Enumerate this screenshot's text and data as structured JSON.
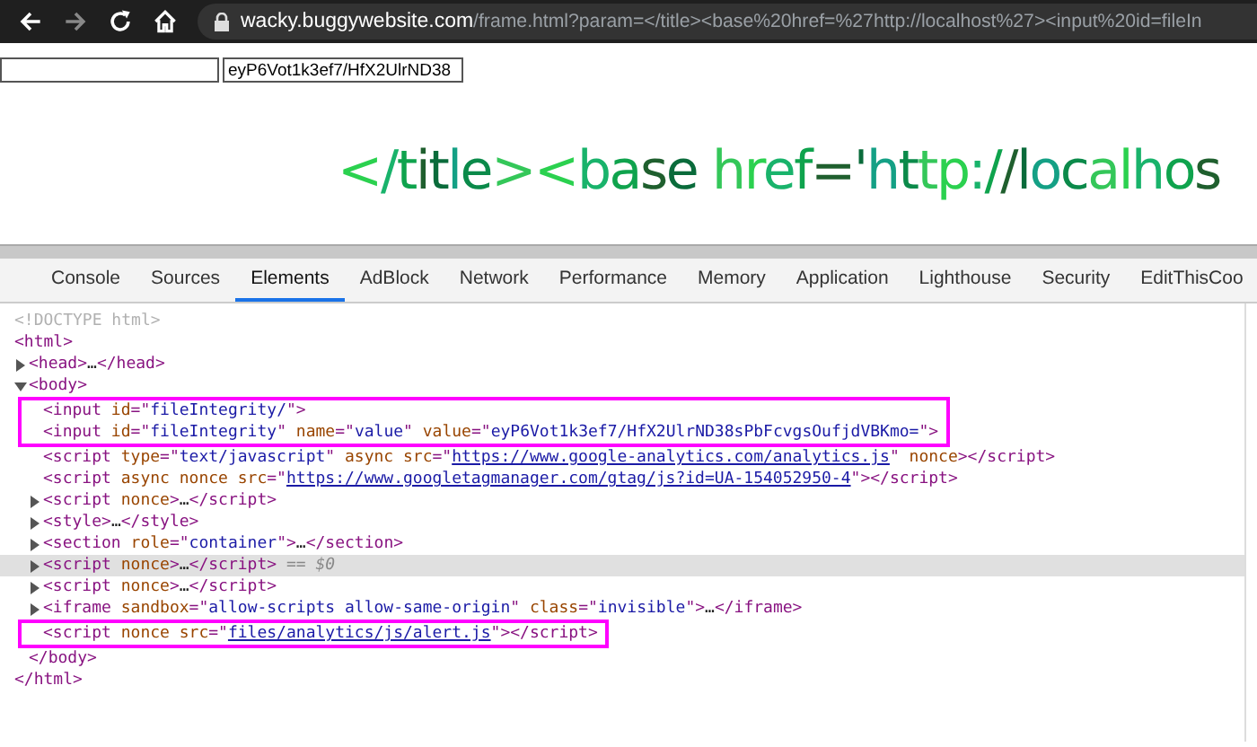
{
  "browser": {
    "url_host": "wacky.buggywebsite.com",
    "url_path": "/frame.html?param=</title><base%20href=%27http://localhost%27><input%20id=fileIn"
  },
  "page": {
    "inputs": [
      {
        "kind": "text"
      },
      {
        "kind": "text",
        "value": "eyP6Vot1k3ef7/HfX2UlrND38"
      }
    ],
    "heading": "</title><base  href='http://localhos"
  },
  "devtools": {
    "tabs": [
      {
        "label": "Console",
        "selected": false
      },
      {
        "label": "Sources",
        "selected": false
      },
      {
        "label": "Elements",
        "selected": true
      },
      {
        "label": "AdBlock",
        "selected": false
      },
      {
        "label": "Network",
        "selected": false
      },
      {
        "label": "Performance",
        "selected": false
      },
      {
        "label": "Memory",
        "selected": false
      },
      {
        "label": "Application",
        "selected": false
      },
      {
        "label": "Lighthouse",
        "selected": false
      },
      {
        "label": "Security",
        "selected": false
      },
      {
        "label": "EditThisCoo",
        "selected": false
      }
    ],
    "dom": [
      {
        "kind": "leaf",
        "selected": false,
        "boxed": false,
        "tokens": [
          {
            "kind": "doctype",
            "text": "<!DOCTYPE html>"
          }
        ]
      },
      {
        "kind": "leaf",
        "selected": false,
        "boxed": false,
        "tokens": [
          {
            "kind": "tag",
            "text": "<html>"
          }
        ],
        "closing": [
          {
            "kind": "tag",
            "text": "</html>"
          }
        ],
        "children": [
          {
            "kind": "collapsed",
            "selected": false,
            "boxed": false,
            "tokens": [
              {
                "kind": "tag",
                "text": "<head>"
              },
              {
                "kind": "text",
                "text": "…"
              },
              {
                "kind": "tag",
                "text": "</head>"
              }
            ]
          },
          {
            "kind": "expanded",
            "selected": false,
            "boxed": false,
            "tokens": [
              {
                "kind": "tag",
                "text": "<body>"
              }
            ],
            "closing": [
              {
                "kind": "tag",
                "text": "</body>"
              }
            ],
            "children": [
              {
                "kind": "leaf",
                "selected": false,
                "boxed": true,
                "tokens": [
                  {
                    "kind": "tag",
                    "text": "<input"
                  },
                  {
                    "kind": "attr",
                    "text": " id"
                  },
                  {
                    "kind": "punct",
                    "text": "=\""
                  },
                  {
                    "kind": "value",
                    "text": "fileIntegrity/"
                  },
                  {
                    "kind": "punct",
                    "text": "\""
                  },
                  {
                    "kind": "tag",
                    "text": ">"
                  }
                ]
              },
              {
                "kind": "leaf",
                "selected": false,
                "boxed": true,
                "tokens": [
                  {
                    "kind": "tag",
                    "text": "<input"
                  },
                  {
                    "kind": "attr",
                    "text": " id"
                  },
                  {
                    "kind": "punct",
                    "text": "=\""
                  },
                  {
                    "kind": "value",
                    "text": "fileIntegrity"
                  },
                  {
                    "kind": "punct",
                    "text": "\""
                  },
                  {
                    "kind": "attr",
                    "text": " name"
                  },
                  {
                    "kind": "punct",
                    "text": "=\""
                  },
                  {
                    "kind": "value",
                    "text": "value"
                  },
                  {
                    "kind": "punct",
                    "text": "\""
                  },
                  {
                    "kind": "attr",
                    "text": " value"
                  },
                  {
                    "kind": "punct",
                    "text": "=\""
                  },
                  {
                    "kind": "value",
                    "text": "eyP6Vot1k3ef7/HfX2UlrND38sPbFcvgsOufjdVBKmo="
                  },
                  {
                    "kind": "punct",
                    "text": "\""
                  },
                  {
                    "kind": "tag",
                    "text": ">"
                  }
                ]
              },
              {
                "kind": "leaf",
                "selected": false,
                "boxed": false,
                "tokens": [
                  {
                    "kind": "tag",
                    "text": "<script"
                  },
                  {
                    "kind": "attr",
                    "text": " type"
                  },
                  {
                    "kind": "punct",
                    "text": "=\""
                  },
                  {
                    "kind": "value",
                    "text": "text/javascript"
                  },
                  {
                    "kind": "punct",
                    "text": "\""
                  },
                  {
                    "kind": "attr",
                    "text": " async src"
                  },
                  {
                    "kind": "punct",
                    "text": "=\""
                  },
                  {
                    "kind": "link",
                    "text": "https://www.google-analytics.com/analytics.js"
                  },
                  {
                    "kind": "punct",
                    "text": "\""
                  },
                  {
                    "kind": "attr",
                    "text": " nonce"
                  },
                  {
                    "kind": "tag",
                    "text": "></script>"
                  }
                ]
              },
              {
                "kind": "leaf",
                "selected": false,
                "boxed": false,
                "tokens": [
                  {
                    "kind": "tag",
                    "text": "<script"
                  },
                  {
                    "kind": "attr",
                    "text": " async nonce src"
                  },
                  {
                    "kind": "punct",
                    "text": "=\""
                  },
                  {
                    "kind": "link",
                    "text": "https://www.googletagmanager.com/gtag/js?id=UA-154052950-4"
                  },
                  {
                    "kind": "punct",
                    "text": "\""
                  },
                  {
                    "kind": "tag",
                    "text": "></script>"
                  }
                ]
              },
              {
                "kind": "collapsed",
                "selected": false,
                "boxed": false,
                "tokens": [
                  {
                    "kind": "tag",
                    "text": "<script"
                  },
                  {
                    "kind": "attr",
                    "text": " nonce"
                  },
                  {
                    "kind": "tag",
                    "text": ">"
                  },
                  {
                    "kind": "text",
                    "text": "…"
                  },
                  {
                    "kind": "tag",
                    "text": "</script>"
                  }
                ]
              },
              {
                "kind": "collapsed",
                "selected": false,
                "boxed": false,
                "tokens": [
                  {
                    "kind": "tag",
                    "text": "<style>"
                  },
                  {
                    "kind": "text",
                    "text": "…"
                  },
                  {
                    "kind": "tag",
                    "text": "</style>"
                  }
                ]
              },
              {
                "kind": "collapsed",
                "selected": false,
                "boxed": false,
                "tokens": [
                  {
                    "kind": "tag",
                    "text": "<section"
                  },
                  {
                    "kind": "attr",
                    "text": " role"
                  },
                  {
                    "kind": "punct",
                    "text": "=\""
                  },
                  {
                    "kind": "value",
                    "text": "container"
                  },
                  {
                    "kind": "punct",
                    "text": "\""
                  },
                  {
                    "kind": "tag",
                    "text": ">"
                  },
                  {
                    "kind": "text",
                    "text": "…"
                  },
                  {
                    "kind": "tag",
                    "text": "</section>"
                  }
                ]
              },
              {
                "kind": "collapsed",
                "selected": true,
                "boxed": false,
                "tokens": [
                  {
                    "kind": "tag",
                    "text": "<script"
                  },
                  {
                    "kind": "attr",
                    "text": " nonce"
                  },
                  {
                    "kind": "tag",
                    "text": ">"
                  },
                  {
                    "kind": "text",
                    "text": "…"
                  },
                  {
                    "kind": "tag",
                    "text": "</script>"
                  },
                  {
                    "kind": "marker",
                    "text": " == $0"
                  }
                ]
              },
              {
                "kind": "collapsed",
                "selected": false,
                "boxed": false,
                "tokens": [
                  {
                    "kind": "tag",
                    "text": "<script"
                  },
                  {
                    "kind": "attr",
                    "text": " nonce"
                  },
                  {
                    "kind": "tag",
                    "text": ">"
                  },
                  {
                    "kind": "text",
                    "text": "…"
                  },
                  {
                    "kind": "tag",
                    "text": "</script>"
                  }
                ]
              },
              {
                "kind": "collapsed",
                "selected": false,
                "boxed": false,
                "tokens": [
                  {
                    "kind": "tag",
                    "text": "<iframe"
                  },
                  {
                    "kind": "attr",
                    "text": " sandbox"
                  },
                  {
                    "kind": "punct",
                    "text": "=\""
                  },
                  {
                    "kind": "value",
                    "text": "allow-scripts allow-same-origin"
                  },
                  {
                    "kind": "punct",
                    "text": "\""
                  },
                  {
                    "kind": "attr",
                    "text": " class"
                  },
                  {
                    "kind": "punct",
                    "text": "=\""
                  },
                  {
                    "kind": "value",
                    "text": "invisible"
                  },
                  {
                    "kind": "punct",
                    "text": "\""
                  },
                  {
                    "kind": "tag",
                    "text": ">"
                  },
                  {
                    "kind": "text",
                    "text": "…"
                  },
                  {
                    "kind": "tag",
                    "text": "</iframe>"
                  }
                ]
              },
              {
                "kind": "leaf",
                "selected": false,
                "boxed": true,
                "tokens": [
                  {
                    "kind": "tag",
                    "text": "<script"
                  },
                  {
                    "kind": "attr",
                    "text": " nonce src"
                  },
                  {
                    "kind": "punct",
                    "text": "=\""
                  },
                  {
                    "kind": "link",
                    "text": "files/analytics/js/alert.js"
                  },
                  {
                    "kind": "punct",
                    "text": "\""
                  },
                  {
                    "kind": "tag",
                    "text": "></script>"
                  }
                ]
              }
            ]
          }
        ]
      }
    ]
  }
}
